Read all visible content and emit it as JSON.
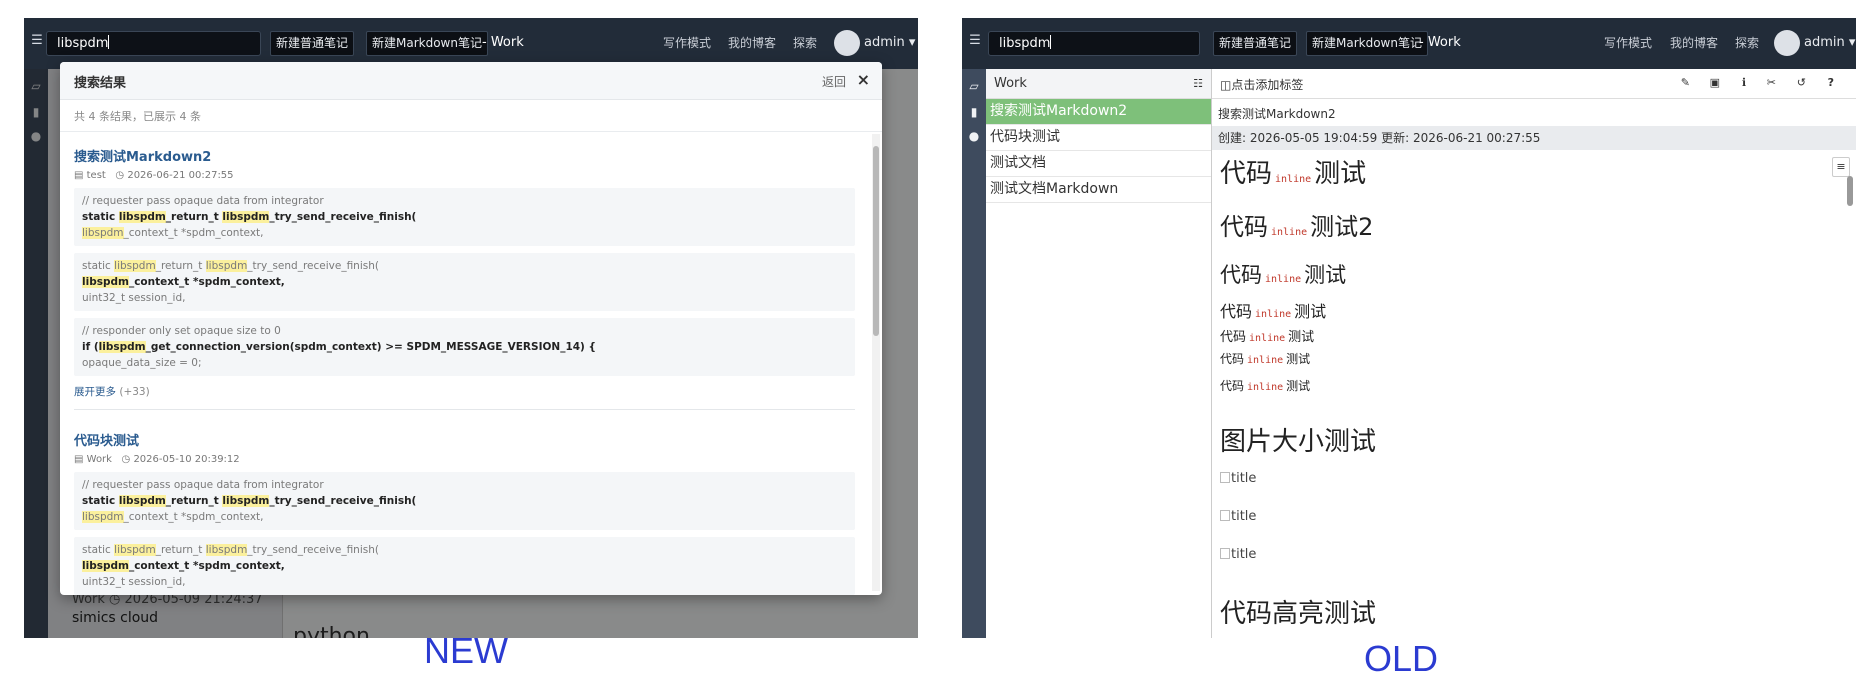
{
  "new": {
    "caption": "NEW",
    "topbar": {
      "search_value": "libspdm",
      "btn_new_note": "新建普通笔记",
      "btn_new_md": "新建Markdown笔记",
      "notebook": "- Work",
      "link_write": "写作模式",
      "link_blog": "我的博客",
      "link_explore": "探索",
      "user": "admin ▾"
    },
    "modal": {
      "title": "搜索结果",
      "back": "返回",
      "close": "×",
      "summary": "共 4 条结果，已展示 4 条",
      "results": [
        {
          "title": "搜索测试Markdown2",
          "notebook": "test",
          "time": "2026-06-21 00:27:55",
          "snippets": [
            {
              "l1": "// requester pass opaque data from integrator",
              "l2a": "static ",
              "l2h1": "libspdm",
              "l2b": "_return_t ",
              "l2h2": "libspdm",
              "l2c": "_try_send_receive_finish(",
              "l3h": "libspdm",
              "l3": "_context_t *spdm_context,"
            },
            {
              "l1a": "static ",
              "l1h1": "libspdm",
              "l1b": "_return_t ",
              "l1h2": "libspdm",
              "l1c": "_try_send_receive_finish(",
              "l2h": "libspdm",
              "l2": "_context_t *spdm_context,",
              "l3": "uint32_t session_id,"
            },
            {
              "l1": "// responder only set opaque size to 0",
              "l2a": "if (",
              "l2h": "libspdm",
              "l2b": "_get_connection_version(spdm_context) >= SPDM_MESSAGE_VERSION_14) {",
              "l3": "opaque_data_size = 0;"
            }
          ],
          "more": "展开更多",
          "more_count": "(+33)"
        },
        {
          "title": "代码块测试",
          "notebook": "Work",
          "time": "2026-05-10 20:39:12",
          "snippets": [
            {
              "l1": "// requester pass opaque data from integrator",
              "l2a": "static ",
              "l2h1": "libspdm",
              "l2b": "_return_t ",
              "l2h2": "libspdm",
              "l2c": "_try_send_receive_finish(",
              "l3h": "libspdm",
              "l3": "_context_t *spdm_context,"
            },
            {
              "l1a": "static ",
              "l1h1": "libspdm",
              "l1b": "_return_t ",
              "l1h2": "libspdm",
              "l1c": "_try_send_receive_finish(",
              "l2h": "libspdm",
              "l2": "_context_t *spdm_context,",
              "l3": "uint32_t session_id,"
            }
          ]
        }
      ]
    },
    "bottom": {
      "meta": "Work ◷ 2026-05-09 21:24:37",
      "item": "simics cloud",
      "content_heading": "python"
    }
  },
  "old": {
    "caption": "OLD",
    "topbar": {
      "search_value": "libspdm",
      "btn_new_note": "新建普通笔记",
      "btn_new_md": "新建Markdown笔记",
      "notebook": "- Work",
      "link_write": "写作模式",
      "link_blog": "我的博客",
      "link_explore": "探索",
      "user": "admin ▾"
    },
    "list_header": "Work",
    "notes": [
      "搜索测试Markdown2",
      "代码块测试",
      "测试文档",
      "测试文档Markdown"
    ],
    "add_tag": "点击添加标签",
    "doc_title": "搜索测试Markdown2",
    "doc_meta": "创建: 2026-05-05 19:04:59    更新: 2026-06-21 00:27:55",
    "headings": [
      {
        "a": "代码",
        "code": "inline",
        "b": "测试"
      },
      {
        "a": "代码",
        "code": "inline",
        "b": "测试2"
      },
      {
        "a": "代码",
        "code": "inline",
        "b": "测试"
      },
      {
        "a": "代码",
        "code": "inline",
        "b": "测试"
      },
      {
        "a": "代码",
        "code": "inline",
        "b": "测试"
      },
      {
        "a": "代码",
        "code": "inline",
        "b": "测试"
      },
      {
        "a": "代码",
        "code": "inline",
        "b": "测试"
      }
    ],
    "section_image": "图片大小测试",
    "images": [
      "title",
      "title",
      "title"
    ],
    "section_code": "代码高亮测试"
  }
}
